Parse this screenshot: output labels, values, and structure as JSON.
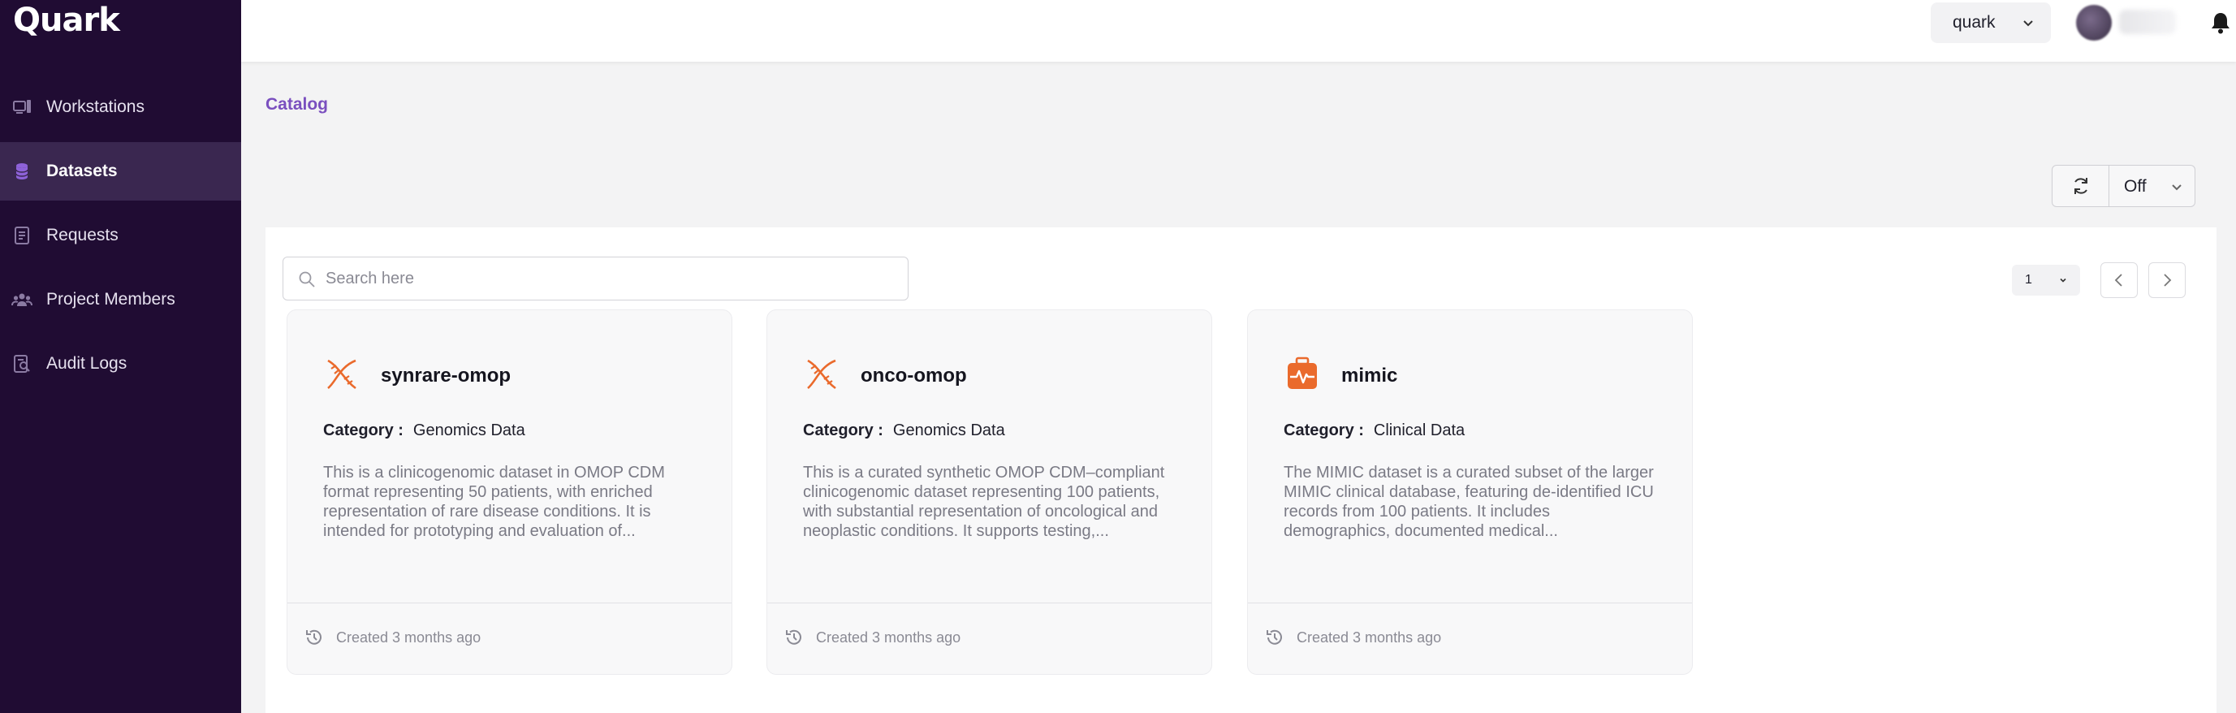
{
  "app": {
    "logo": "Quark"
  },
  "colors": {
    "sidebar_bg": "#200c33",
    "accent": "#7a4fbf",
    "dataset_icon": "#ea6a2c"
  },
  "sidebar": {
    "items": [
      {
        "label": "Workstations",
        "icon": "workstation-icon",
        "active": false
      },
      {
        "label": "Datasets",
        "icon": "database-icon",
        "active": true
      },
      {
        "label": "Requests",
        "icon": "requests-icon",
        "active": false
      },
      {
        "label": "Project Members",
        "icon": "members-icon",
        "active": false
      },
      {
        "label": "Audit Logs",
        "icon": "audit-log-icon",
        "active": false
      }
    ]
  },
  "header": {
    "project": "quark",
    "notifications_icon": "bell-icon"
  },
  "breadcrumb": "Catalog",
  "refresh": {
    "value": "Off",
    "icon": "refresh-icon"
  },
  "search": {
    "placeholder": "Search here",
    "value": ""
  },
  "pagination": {
    "page": "1"
  },
  "datasets": [
    {
      "name": "synrare-omop",
      "icon": "dna-icon",
      "category_label": "Category :",
      "category": "Genomics Data",
      "description": "This is a clinicogenomic dataset in OMOP CDM format representing 50 patients, with enriched representation of rare disease conditions. It is intended for prototyping and evaluation of...",
      "created": "Created 3 months ago"
    },
    {
      "name": "onco-omop",
      "icon": "dna-icon",
      "category_label": "Category :",
      "category": "Genomics Data",
      "description": "This is a curated synthetic OMOP CDM–compliant clinicogenomic dataset representing 100 patients, with substantial representation of oncological and neoplastic conditions. It supports testing,...",
      "created": "Created 3 months ago"
    },
    {
      "name": "mimic",
      "icon": "medical-kit-icon",
      "category_label": "Category :",
      "category": "Clinical Data",
      "description": "The MIMIC dataset is a curated subset of the larger MIMIC clinical database, featuring de-identified ICU records from 100 patients. It includes demographics, documented medical...",
      "created": "Created 3 months ago"
    }
  ]
}
